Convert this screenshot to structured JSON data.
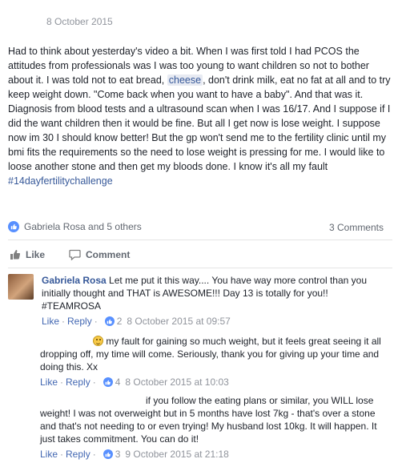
{
  "post": {
    "date": "8 October 2015",
    "text_part1": "Had to think about yesterday's video a bit. When I was first told I had PCOS the attitudes from professionals was I was too young to want children so not to bother about it. I was told not to eat bread, ",
    "highlight": "cheese",
    "text_part2": ", don't drink milk, eat no fat at all and to try keep weight down. \"Come back when you want to have a baby\". And that was it. Diagnosis from blood tests and a ultrasound scan when I was 16/17. And I suppose if I did the want children then it would be fine. But all I get now is lose weight. I suppose now im 30 I should know better! But the gp won't send me to the fertility clinic until my bmi fits the requirements so the need to lose weight is pressing for me. I would like to loose another stone and then get my bloods done. I know it's all my fault ",
    "hashtag": "#14dayfertilitychallenge"
  },
  "reactions": {
    "names": "Gabriela Rosa and 5 others",
    "comments_count": "3 Comments"
  },
  "actions": {
    "like": "Like",
    "comment": "Comment"
  },
  "comments": [
    {
      "name": "Gabriela Rosa",
      "text": "Let me put it this way.... You have way more control than you initially thought and THAT is AWESOME!!! Day 13 is totally for you!! #TEAMROSA",
      "like_label": "Like",
      "reply_label": "Reply",
      "likes": "2",
      "timestamp": "8 October 2015 at 09:57"
    },
    {
      "text": " my fault for gaining so much weight, but it feels great seeing it all dropping off, my time will come. Seriously, thank you for giving up your time and doing this. Xx",
      "like_label": "Like",
      "reply_label": "Reply",
      "likes": "4",
      "timestamp": "8 October 2015 at 10:03"
    },
    {
      "text": "if you follow the eating plans or similar, you WILL lose weight! I was not overweight but in 5 months have lost 7kg - that's over a stone and that's not needing to or even trying! My husband lost 10kg. It will happen. It just takes commitment. You can do it!",
      "like_label": "Like",
      "reply_label": "Reply",
      "likes": "3",
      "timestamp": "9 October 2015 at 21:18"
    }
  ],
  "colors": {
    "link": "#365899",
    "meta": "#90949c",
    "like_blue": "#5890ff"
  }
}
